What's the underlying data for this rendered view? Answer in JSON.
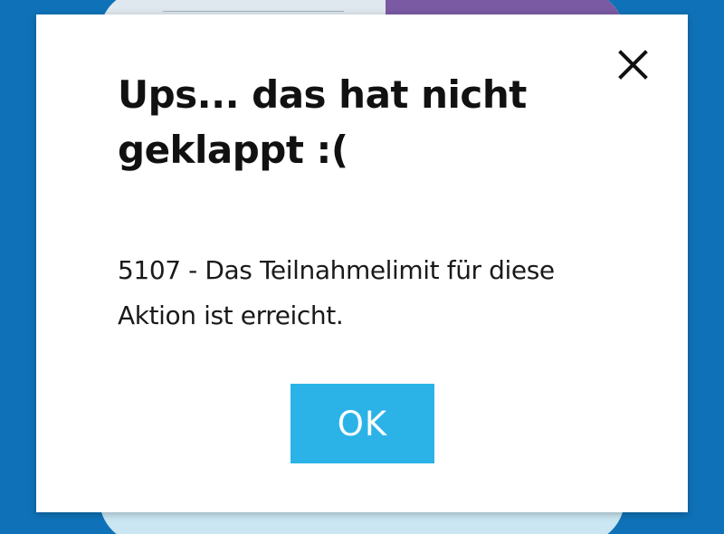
{
  "modal": {
    "title": "Ups... das hat nicht geklappt :(",
    "message": "5107 - Das Teilnahmelimit für diese Aktion ist erreicht.",
    "ok_label": "OK",
    "close_icon": "close-icon"
  },
  "colors": {
    "background": "#0f72b8",
    "button": "#2bb3e8"
  }
}
